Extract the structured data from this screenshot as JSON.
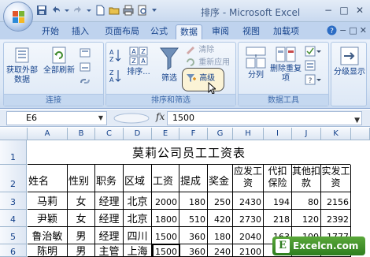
{
  "window": {
    "title": "排序 - Microsoft Excel",
    "controls": [
      "−",
      "□",
      "✕"
    ]
  },
  "tabs": [
    {
      "label": "开始"
    },
    {
      "label": "插入"
    },
    {
      "label": "页面布局"
    },
    {
      "label": "公式"
    },
    {
      "label": "数据",
      "active": true
    },
    {
      "label": "审阅"
    },
    {
      "label": "视图"
    },
    {
      "label": "加载项"
    }
  ],
  "ribbon": {
    "groups": [
      {
        "label": "连接"
      },
      {
        "label": "排序和筛选"
      },
      {
        "label": "数据工具"
      }
    ],
    "get_external_data": "获取外部数据",
    "refresh_all": "全部刷新",
    "sort_label": "排序...",
    "filter_label": "筛选",
    "clear_label": "清除",
    "reapply_label": "重新应用",
    "advanced_label": "高级",
    "text_to_columns": "分列",
    "remove_dup": "删除重复项",
    "outline_label": "分级显示"
  },
  "formula_bar": {
    "cell_ref": "E6",
    "fx": "fx",
    "content": "1500"
  },
  "columns": [
    "A",
    "B",
    "C",
    "D",
    "E",
    "F",
    "G",
    "H",
    "I",
    "J",
    "K"
  ],
  "rows": [
    "1",
    "2",
    "3",
    "4",
    "5",
    "6"
  ],
  "sheet": {
    "title": "莫莉公司员工工资表",
    "headers": [
      "姓名",
      "性别",
      "职务",
      "区域",
      "工资",
      "提成",
      "奖金",
      "应发工资",
      "代扣保险",
      "其他扣款",
      "实发工资"
    ],
    "data": [
      [
        "马莉",
        "女",
        "经理",
        "北京",
        "2000",
        "180",
        "250",
        "2430",
        "194",
        "80",
        "2156"
      ],
      [
        "尹颖",
        "女",
        "经理",
        "北京",
        "1800",
        "510",
        "420",
        "2730",
        "218",
        "120",
        "2392"
      ],
      [
        "鲁治敏",
        "男",
        "经理",
        "四川",
        "1500",
        "360",
        "180",
        "2040",
        "163",
        "100",
        "1777"
      ],
      [
        "陈明",
        "男",
        "主管",
        "上海",
        "1500",
        "360",
        "240",
        "2100",
        "",
        "",
        ""
      ]
    ]
  },
  "watermark": {
    "logo": "E",
    "text": "Excelcn.com"
  },
  "colors": {
    "ribbon_bg": "#dce7f5",
    "tab_active": "#eaf1fb",
    "accent": "#15428b",
    "watermark_green": "#2e7d1e"
  }
}
